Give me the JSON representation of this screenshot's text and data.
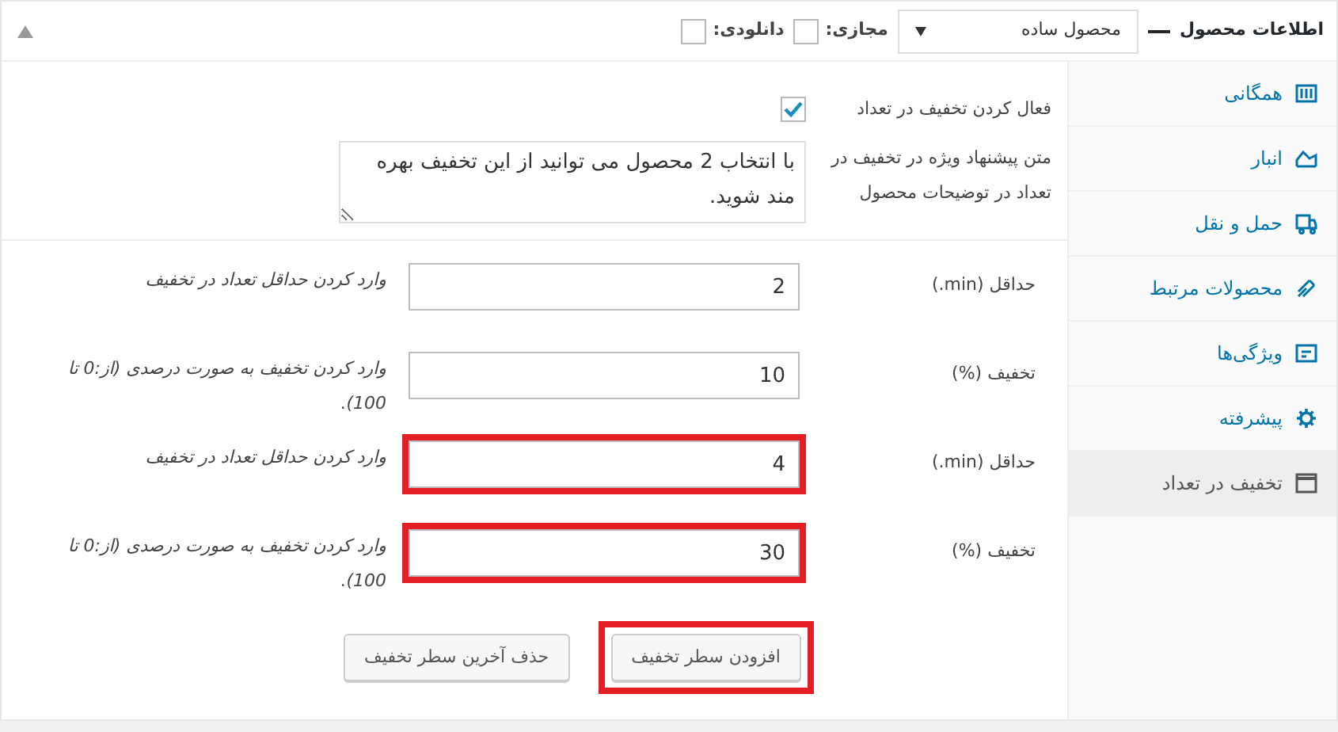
{
  "header": {
    "title": "اطلاعات محصول",
    "product_type": "محصول ساده",
    "options": [
      {
        "label": "مجازی:",
        "checked": false
      },
      {
        "label": "دانلودی:",
        "checked": false
      }
    ]
  },
  "sidebar": {
    "tabs": [
      {
        "label": "همگانی",
        "kind": "grid",
        "selected": false
      },
      {
        "label": "انبار",
        "kind": "stock",
        "selected": false
      },
      {
        "label": "حمل و نقل",
        "kind": "truck",
        "selected": false
      },
      {
        "label": "محصولات مرتبط",
        "kind": "link",
        "selected": false
      },
      {
        "label": "ویژگی‌ها",
        "kind": "list",
        "selected": false
      },
      {
        "label": "پیشرفته",
        "kind": "gear",
        "selected": false
      },
      {
        "label": "تخفیف در تعداد",
        "kind": "window",
        "selected": true
      }
    ]
  },
  "enable": {
    "label": "فعال کردن تخفیف در تعداد",
    "checked": true
  },
  "offer_text": {
    "label": "متن پیشنهاد ویژه در تخفیف در تعداد در توضیحات محصول",
    "value": "با انتخاب 2 محصول می توانید از این تخفیف بهره مند شوید."
  },
  "rows": [
    {
      "label": "حداقل (min.)",
      "value": "2",
      "description": "وارد کردن حداقل تعداد در تخفیف",
      "highlighted": false
    },
    {
      "label": "تخفیف (%)",
      "value": "10",
      "description": "وارد کردن تخفیف به صورت درصدی (از:0 تا 100).",
      "highlighted": false
    },
    {
      "label": "حداقل (min.)",
      "value": "4",
      "description": "وارد کردن حداقل تعداد در تخفیف",
      "highlighted": true
    },
    {
      "label": "تخفیف (%)",
      "value": "30",
      "description": "وارد کردن تخفیف به صورت درصدی (از:0 تا 100).",
      "highlighted": true
    }
  ],
  "buttons": [
    {
      "label": "افزودن سطر تخفیف",
      "highlighted": true
    },
    {
      "label": "حذف آخرین سطر تخفیف",
      "highlighted": false
    }
  ]
}
